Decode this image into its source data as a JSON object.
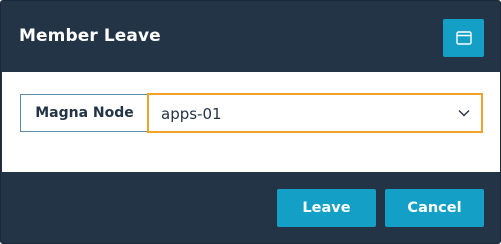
{
  "dialog": {
    "title": "Member Leave",
    "maximize_icon": "window-icon"
  },
  "form": {
    "field_label": "Magna Node",
    "select_value": "apps-01",
    "select_icon": "chevron-down-icon"
  },
  "footer": {
    "leave_label": "Leave",
    "cancel_label": "Cancel"
  },
  "colors": {
    "header_bg": "#233447",
    "accent": "#14a0c6",
    "focus_border": "#f0a326"
  }
}
